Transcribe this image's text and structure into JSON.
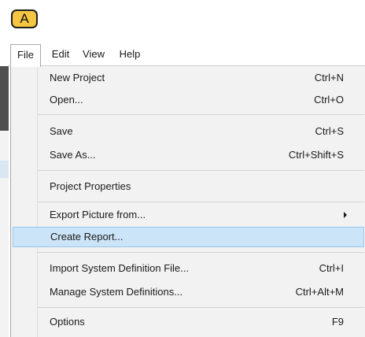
{
  "badge": {
    "label": "A"
  },
  "menubar": {
    "items": [
      {
        "label": "File"
      },
      {
        "label": "Edit"
      },
      {
        "label": "View"
      },
      {
        "label": "Help"
      }
    ]
  },
  "file_menu": {
    "items": [
      {
        "label": "New Project",
        "shortcut": "Ctrl+N"
      },
      {
        "label": "Open...",
        "shortcut": "Ctrl+O"
      },
      {
        "label": "Save",
        "shortcut": "Ctrl+S"
      },
      {
        "label": "Save As...",
        "shortcut": "Ctrl+Shift+S"
      },
      {
        "label": "Project Properties",
        "shortcut": ""
      },
      {
        "label": "Export Picture from...",
        "shortcut": ""
      },
      {
        "label": "Create Report...",
        "shortcut": ""
      },
      {
        "label": "Import System Definition File...",
        "shortcut": "Ctrl+I"
      },
      {
        "label": "Manage System Definitions...",
        "shortcut": "Ctrl+Alt+M"
      },
      {
        "label": "Options",
        "shortcut": "F9"
      }
    ],
    "highlighted_item": "Create Report...",
    "submenu_icon": "chevron-right-icon"
  },
  "colors": {
    "badge": "#f6c542",
    "highlight_bg": "#cce4f7",
    "highlight_border": "#99c9ef",
    "menu_bg": "#f2f2f2"
  }
}
